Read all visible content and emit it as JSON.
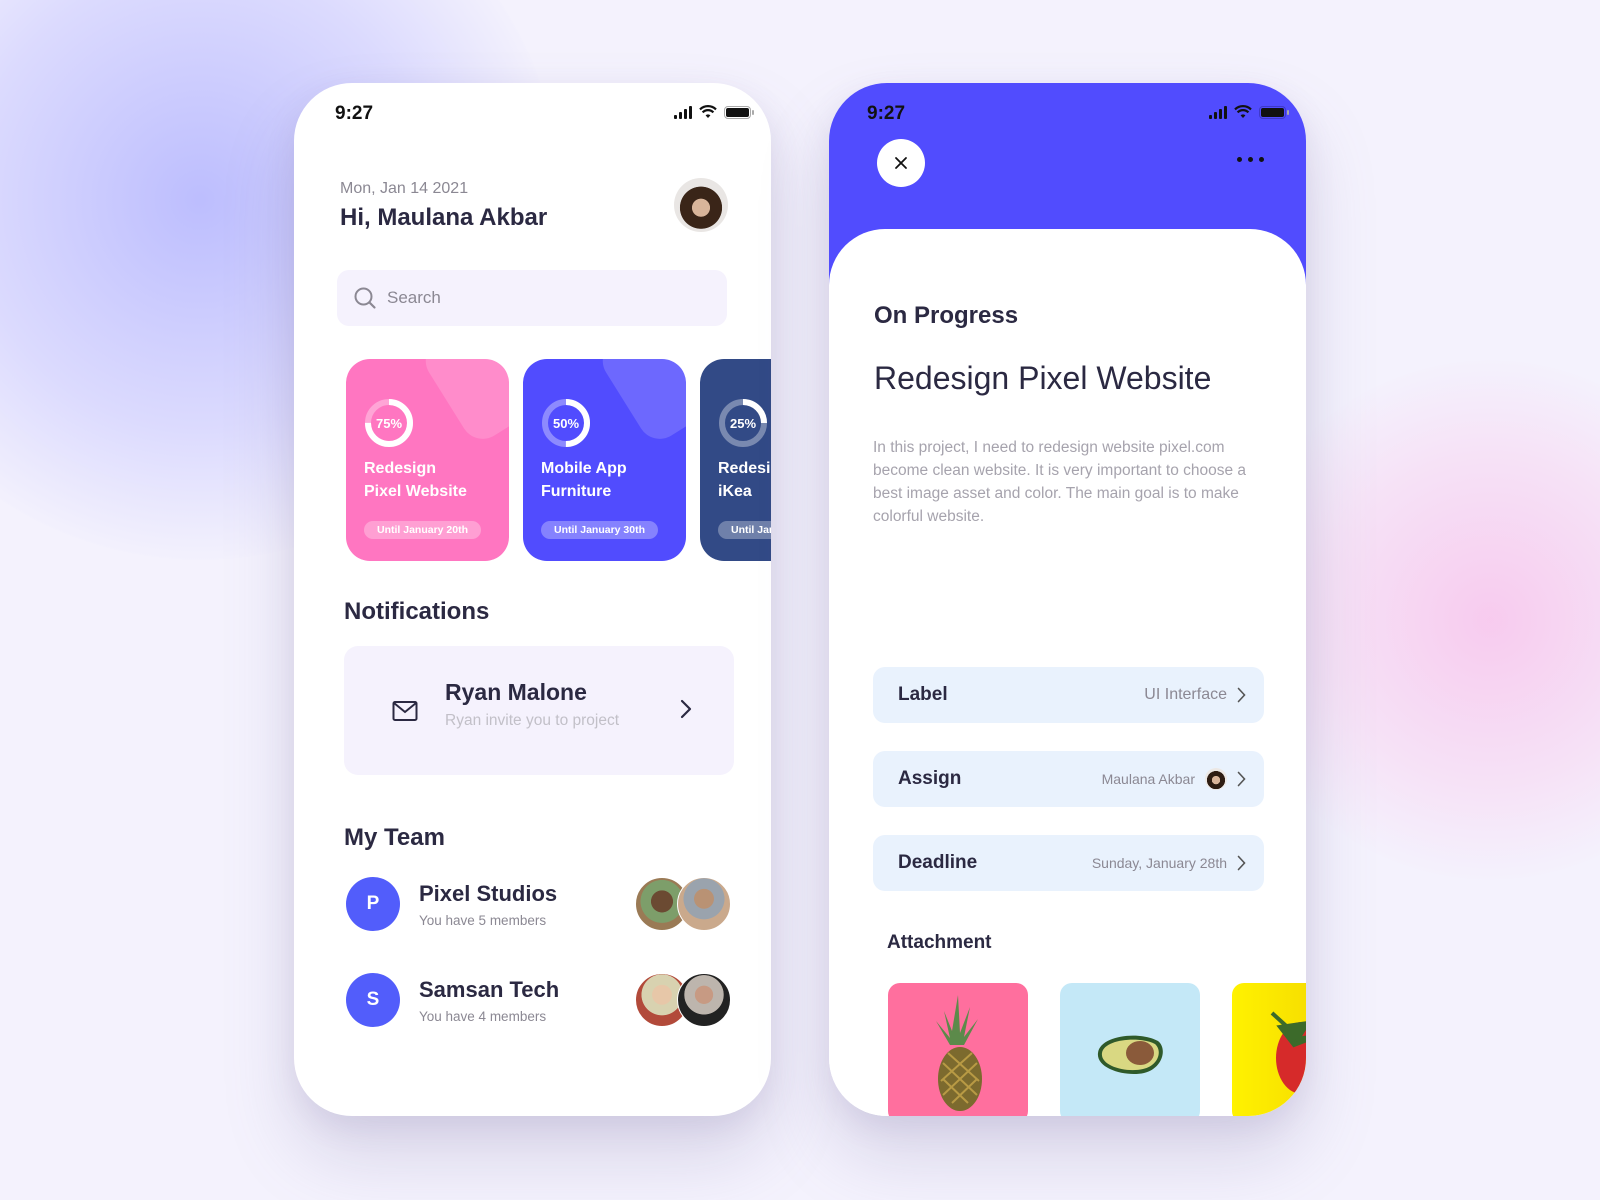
{
  "colors": {
    "accent": "#514cfe",
    "pink_card": "#ff76c1",
    "blue_card": "#514cfe",
    "navy_card": "#324a86",
    "text_dark": "#2b2942",
    "text_muted": "#8b8893",
    "row_bg": "#e9f2fd"
  },
  "status_bar": {
    "time": "9:27"
  },
  "home": {
    "date": "Mon, Jan 14 2021",
    "greeting": "Hi, Maulana Akbar",
    "avatar_icon": "user-avatar",
    "search": {
      "placeholder": "Search",
      "value": "",
      "icon": "search-icon"
    },
    "projects": [
      {
        "progress_label": "75%",
        "progress": 0.75,
        "title": "Redesign\nPixel Website",
        "due": "Until January 20th",
        "color": "#ff76c1"
      },
      {
        "progress_label": "50%",
        "progress": 0.5,
        "title": "Mobile App\nFurniture",
        "due": "Until January 30th",
        "color": "#514cfe"
      },
      {
        "progress_label": "25%",
        "progress": 0.25,
        "title": "Redesign\niKea",
        "due": "Until January",
        "color": "#324a86"
      }
    ],
    "notifications": {
      "title": "Notifications",
      "items": [
        {
          "icon": "mail-icon",
          "name": "Ryan Malone",
          "message": "Ryan invite you to project"
        }
      ]
    },
    "team": {
      "title": "My Team",
      "items": [
        {
          "initial": "P",
          "name": "Pixel Studios",
          "members": "You have 5 members"
        },
        {
          "initial": "S",
          "name": "Samsan Tech",
          "members": "You have 4 members"
        }
      ]
    }
  },
  "detail": {
    "close_icon": "close-icon",
    "more_icon": "more-horizontal-icon",
    "status": "On Progress",
    "title": "Redesign Pixel Website",
    "description": "In this project, I need to redesign website pixel.com become clean website. It is very important to choose a best image asset and color. The main goal is to make colorful website.",
    "properties": [
      {
        "key": "Label",
        "value": "UI Interface"
      },
      {
        "key": "Assign",
        "value": "Maulana Akbar"
      },
      {
        "key": "Deadline",
        "value": "Sunday, January 28th"
      }
    ],
    "attachment_title": "Attachment",
    "attachments": [
      {
        "name": "pineapple",
        "bg": "#ff6f9e"
      },
      {
        "name": "avocado",
        "bg": "#c4e8f7"
      },
      {
        "name": "strawberry",
        "bg": "#fde800"
      }
    ]
  }
}
